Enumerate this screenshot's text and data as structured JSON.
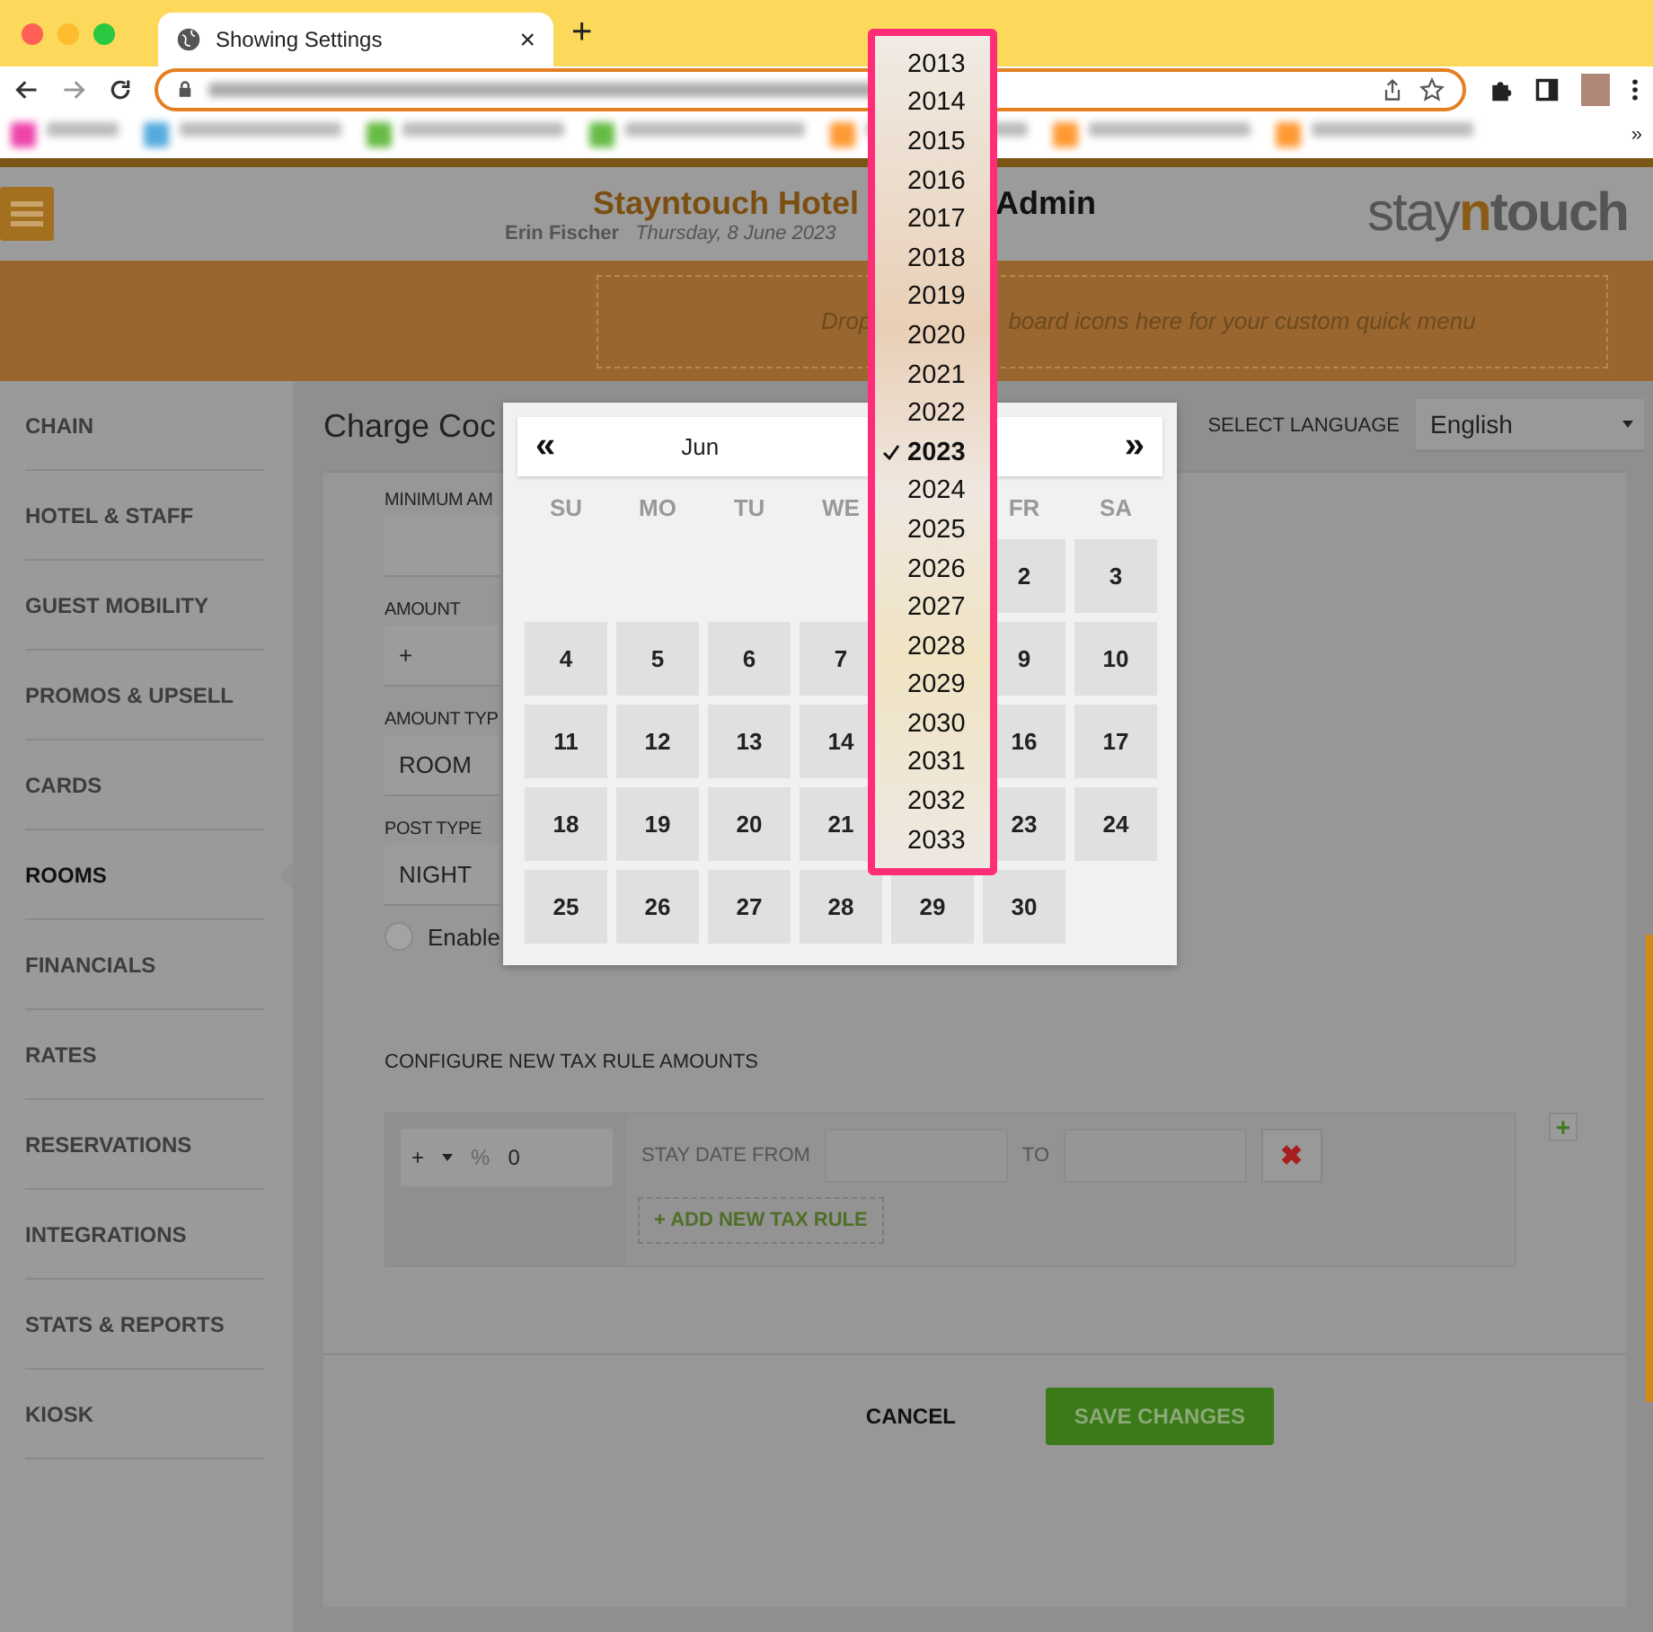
{
  "browser": {
    "tab_title": "Showing Settings",
    "tab_close": "×",
    "new_tab": "+",
    "bookmarks_overflow": "»"
  },
  "header": {
    "title_start": "Stayntouch Hotel",
    "title_end": "Admin",
    "user": "Erin Fischer",
    "date": "Thursday, 8 June 2023",
    "logo": [
      "stay",
      "n",
      "touch"
    ]
  },
  "quick_menu": {
    "text_start": "Drop",
    "text_end": "board icons here for your custom quick menu"
  },
  "sidebar": {
    "items": [
      {
        "label": "CHAIN",
        "selected": false
      },
      {
        "label": "HOTEL & STAFF",
        "selected": false
      },
      {
        "label": "GUEST MOBILITY",
        "selected": false
      },
      {
        "label": "PROMOS & UPSELL",
        "selected": false
      },
      {
        "label": "CARDS",
        "selected": false
      },
      {
        "label": "ROOMS",
        "selected": true
      },
      {
        "label": "FINANCIALS",
        "selected": false
      },
      {
        "label": "RATES",
        "selected": false
      },
      {
        "label": "RESERVATIONS",
        "selected": false
      },
      {
        "label": "INTEGRATIONS",
        "selected": false
      },
      {
        "label": "STATS & REPORTS",
        "selected": false
      },
      {
        "label": "KIOSK",
        "selected": false
      }
    ]
  },
  "page": {
    "title": "Charge Coc",
    "language_label": "SELECT LANGUAGE",
    "language": "English"
  },
  "form": [
    {
      "kind": "input",
      "label": "MINIMUM AM"
    },
    {
      "kind": "select",
      "label": "AMOUNT",
      "value": "+"
    },
    {
      "kind": "select",
      "label": "AMOUNT TYP",
      "value": "ROOM"
    },
    {
      "kind": "select",
      "label": "POST TYPE",
      "value": "NIGHT"
    },
    {
      "kind": "toggle",
      "label": "Enable",
      "checked": false
    }
  ],
  "tax": {
    "heading": "CONFIGURE NEW TAX RULE AMOUNTS",
    "sign": "+",
    "percent": "%",
    "amount": "0",
    "from_label": "STAY DATE FROM",
    "to_label": "TO",
    "delete": "✖",
    "add_rule": "+ ADD NEW TAX RULE",
    "add": "+"
  },
  "actions": {
    "cancel": "CANCEL",
    "save": "SAVE CHANGES"
  },
  "calendar": {
    "prev": "«",
    "month": "Jun",
    "next": "»",
    "weekdays": [
      {
        "kind": "label",
        "label": "SU"
      },
      {
        "kind": "label",
        "label": "MO"
      },
      {
        "kind": "label",
        "label": "TU"
      },
      {
        "kind": "label",
        "label": "WE"
      },
      {
        "kind": "blank"
      },
      {
        "kind": "label",
        "label": "FR"
      },
      {
        "kind": "label",
        "label": "SA"
      }
    ],
    "weeks": [
      [
        {
          "kind": "blank"
        },
        {
          "kind": "blank"
        },
        {
          "kind": "blank"
        },
        {
          "kind": "blank"
        },
        {
          "kind": "blank"
        },
        {
          "kind": "day",
          "label": "2"
        },
        {
          "kind": "day",
          "label": "3"
        }
      ],
      [
        {
          "kind": "day",
          "label": "4"
        },
        {
          "kind": "day",
          "label": "5"
        },
        {
          "kind": "day",
          "label": "6"
        },
        {
          "kind": "day",
          "label": "7"
        },
        {
          "kind": "blank"
        },
        {
          "kind": "day",
          "label": "9"
        },
        {
          "kind": "day",
          "label": "10"
        }
      ],
      [
        {
          "kind": "day",
          "label": "11"
        },
        {
          "kind": "day",
          "label": "12"
        },
        {
          "kind": "day",
          "label": "13"
        },
        {
          "kind": "day",
          "label": "14"
        },
        {
          "kind": "blank"
        },
        {
          "kind": "day",
          "label": "16"
        },
        {
          "kind": "day",
          "label": "17"
        }
      ],
      [
        {
          "kind": "day",
          "label": "18"
        },
        {
          "kind": "day",
          "label": "19"
        },
        {
          "kind": "day",
          "label": "20"
        },
        {
          "kind": "day",
          "label": "21"
        },
        {
          "kind": "blank"
        },
        {
          "kind": "day",
          "label": "23"
        },
        {
          "kind": "day",
          "label": "24"
        }
      ],
      [
        {
          "kind": "day",
          "label": "25"
        },
        {
          "kind": "day",
          "label": "26"
        },
        {
          "kind": "day",
          "label": "27"
        },
        {
          "kind": "day",
          "label": "28"
        },
        {
          "kind": "day",
          "label": "29"
        },
        {
          "kind": "day",
          "label": "30"
        },
        {
          "kind": "blank"
        }
      ]
    ]
  },
  "year_dropdown": [
    {
      "label": "2013",
      "selected": false
    },
    {
      "label": "2014",
      "selected": false
    },
    {
      "label": "2015",
      "selected": false
    },
    {
      "label": "2016",
      "selected": false
    },
    {
      "label": "2017",
      "selected": false
    },
    {
      "label": "2018",
      "selected": false
    },
    {
      "label": "2019",
      "selected": false
    },
    {
      "label": "2020",
      "selected": false
    },
    {
      "label": "2021",
      "selected": false
    },
    {
      "label": "2022",
      "selected": false
    },
    {
      "label": "2023",
      "selected": true
    },
    {
      "label": "2024",
      "selected": false
    },
    {
      "label": "2025",
      "selected": false
    },
    {
      "label": "2026",
      "selected": false
    },
    {
      "label": "2027",
      "selected": false
    },
    {
      "label": "2028",
      "selected": false
    },
    {
      "label": "2029",
      "selected": false
    },
    {
      "label": "2030",
      "selected": false
    },
    {
      "label": "2031",
      "selected": false
    },
    {
      "label": "2032",
      "selected": false
    },
    {
      "label": "2033",
      "selected": false
    }
  ]
}
